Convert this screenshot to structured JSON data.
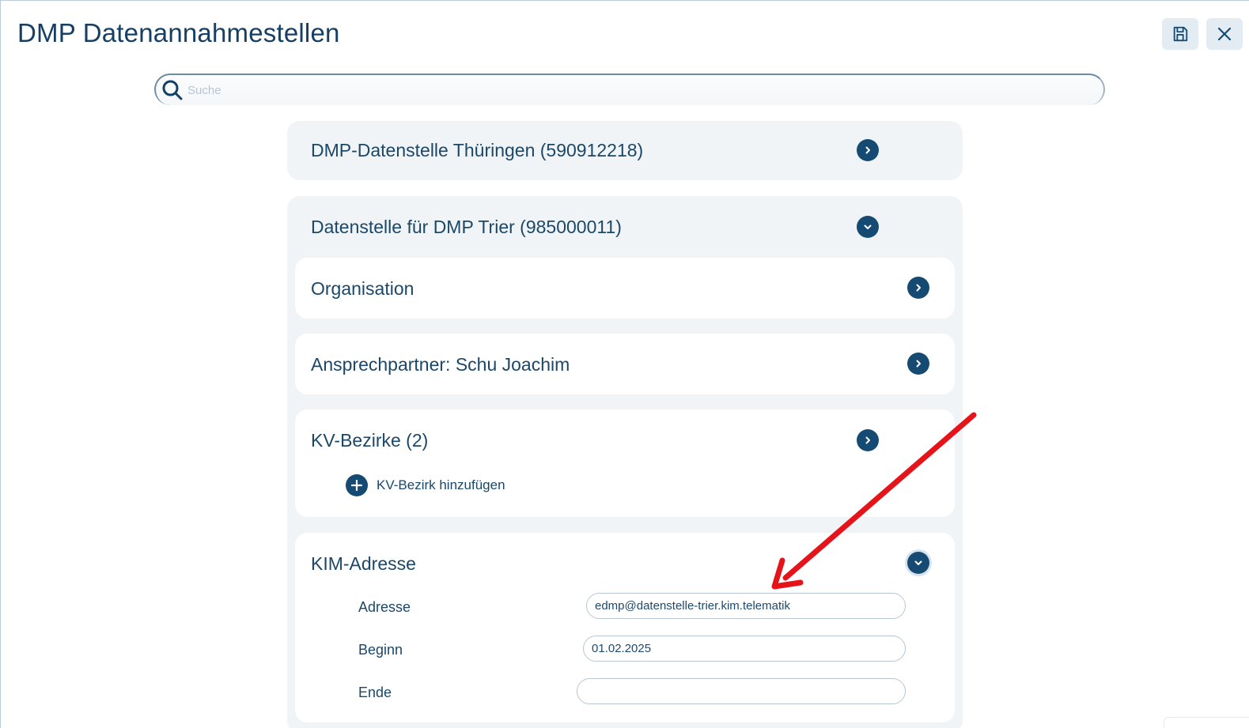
{
  "window": {
    "title": "DMP Datenannahmestellen"
  },
  "toolbar": {
    "save_icon": "save-icon",
    "close_icon": "close-icon"
  },
  "search": {
    "placeholder": "Suche",
    "value": ""
  },
  "entries": [
    {
      "label": "DMP-Datenstelle Thüringen (590912218)",
      "expanded": false
    },
    {
      "label": "Datenstelle für DMP Trier (985000011)",
      "expanded": true,
      "sections": {
        "organisation": {
          "label": "Organisation",
          "expanded": false
        },
        "ansprechpartner": {
          "label": "Ansprechpartner: Schu Joachim",
          "expanded": false
        },
        "kv_bezirke": {
          "label": "KV-Bezirke (2)",
          "expanded": false,
          "add_label": "KV-Bezirk hinzufügen"
        },
        "kim": {
          "label": "KIM-Adresse",
          "expanded": true,
          "fields": [
            {
              "label": "Adresse",
              "value": "edmp@datenstelle-trier.kim.telematik"
            },
            {
              "label": "Beginn",
              "value": "01.02.2025"
            },
            {
              "label": "Ende",
              "value": ""
            }
          ]
        }
      }
    }
  ],
  "colors": {
    "accent": "#154a73",
    "card_bg": "#f1f4f7",
    "annotation_arrow": "#e5141b"
  }
}
